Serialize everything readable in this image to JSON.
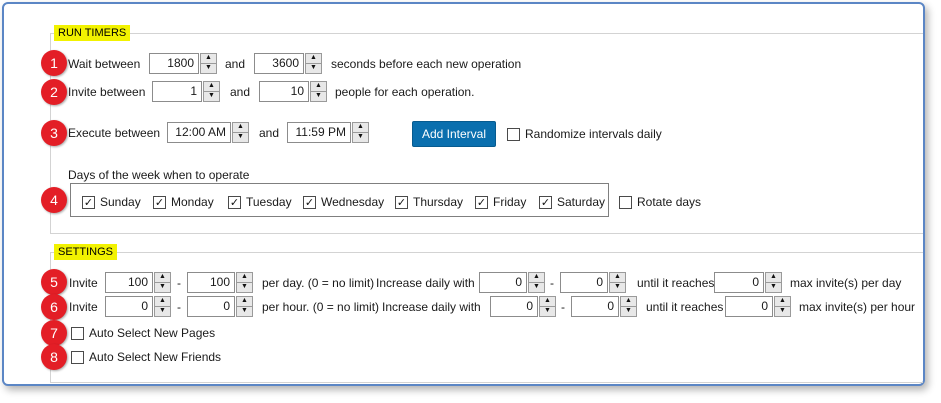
{
  "run_timers": {
    "title": "RUN TIMERS",
    "wait": {
      "label": "Wait between",
      "min": "1800",
      "and": "and",
      "max": "3600",
      "suffix": "seconds before each new operation"
    },
    "invite": {
      "label": "Invite between",
      "min": "1",
      "and": "and",
      "max": "10",
      "suffix": "people for each operation."
    },
    "execute": {
      "label": "Execute between",
      "start": "12:00 AM",
      "and": "and",
      "end": "11:59 PM",
      "add_interval": "Add Interval",
      "randomize_label": "Randomize intervals daily",
      "randomize_checked": false
    },
    "days": {
      "caption": "Days of the week when to operate",
      "items": [
        {
          "label": "Sunday",
          "checked": true
        },
        {
          "label": "Monday",
          "checked": true
        },
        {
          "label": "Tuesday",
          "checked": true
        },
        {
          "label": "Wednesday",
          "checked": true
        },
        {
          "label": "Thursday",
          "checked": true
        },
        {
          "label": "Friday",
          "checked": true
        },
        {
          "label": "Saturday",
          "checked": true
        }
      ],
      "rotate_label": "Rotate days",
      "rotate_checked": false
    }
  },
  "settings": {
    "title": "SETTINGS",
    "per_day": {
      "label": "Invite",
      "min": "100",
      "dash": "-",
      "max": "100",
      "desc": "per day. (0 = no limit)",
      "increase_label": "Increase daily with",
      "inc_min": "0",
      "dash2": "-",
      "inc_max": "0",
      "until_label": "until it reaches",
      "cap": "0",
      "cap_label": "max invite(s) per day"
    },
    "per_hour": {
      "label": "Invite",
      "min": "0",
      "dash": "-",
      "max": "0",
      "desc": "per hour. (0 = no limit)",
      "increase_label": "Increase daily with",
      "inc_min": "0",
      "dash2": "-",
      "inc_max": "0",
      "until_label": "until it reaches",
      "cap": "0",
      "cap_label": "max invite(s) per hour"
    },
    "auto_pages": {
      "label": "Auto Select New Pages",
      "checked": false
    },
    "auto_friends": {
      "label": "Auto Select New Friends",
      "checked": false
    }
  },
  "badges": [
    "1",
    "2",
    "3",
    "4",
    "5",
    "6",
    "7",
    "8"
  ],
  "icons": {
    "spin_up": "▲",
    "spin_down": "▼",
    "check": "✓"
  },
  "colors": {
    "badge": "#e31e26",
    "legend_highlight": "#f2f200",
    "primary_button": "#0a6fae",
    "frame_border": "#5b86c5"
  }
}
